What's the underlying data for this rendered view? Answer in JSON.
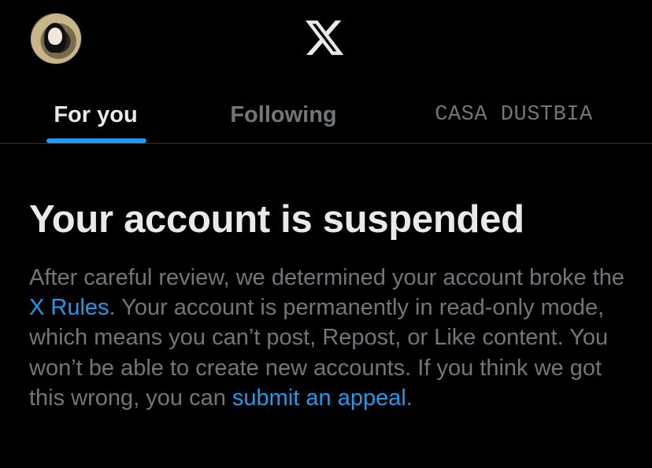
{
  "header": {
    "avatar_icon": "profile-avatar",
    "logo_icon": "x-logo-icon"
  },
  "tabs": [
    {
      "label": "For you",
      "active": true
    },
    {
      "label": "Following",
      "active": false
    },
    {
      "label": "CASA DUSTBIA",
      "active": false
    }
  ],
  "notice": {
    "title": "Your account is suspended",
    "body_part1": "After careful review, we determined your account broke the ",
    "rules_link": "X Rules",
    "body_part2": ". Your account is permanently in read-only mode, which means you can’t post, Repost, or Like content. You won’t be able to create new accounts. If you think we got this wrong, you can ",
    "appeal_link": "submit an appeal",
    "body_part3": "."
  },
  "colors": {
    "background": "#000000",
    "text_primary": "#e7e9ea",
    "text_secondary": "#71767b",
    "accent": "#1d9bf0",
    "divider": "#2f3336"
  }
}
